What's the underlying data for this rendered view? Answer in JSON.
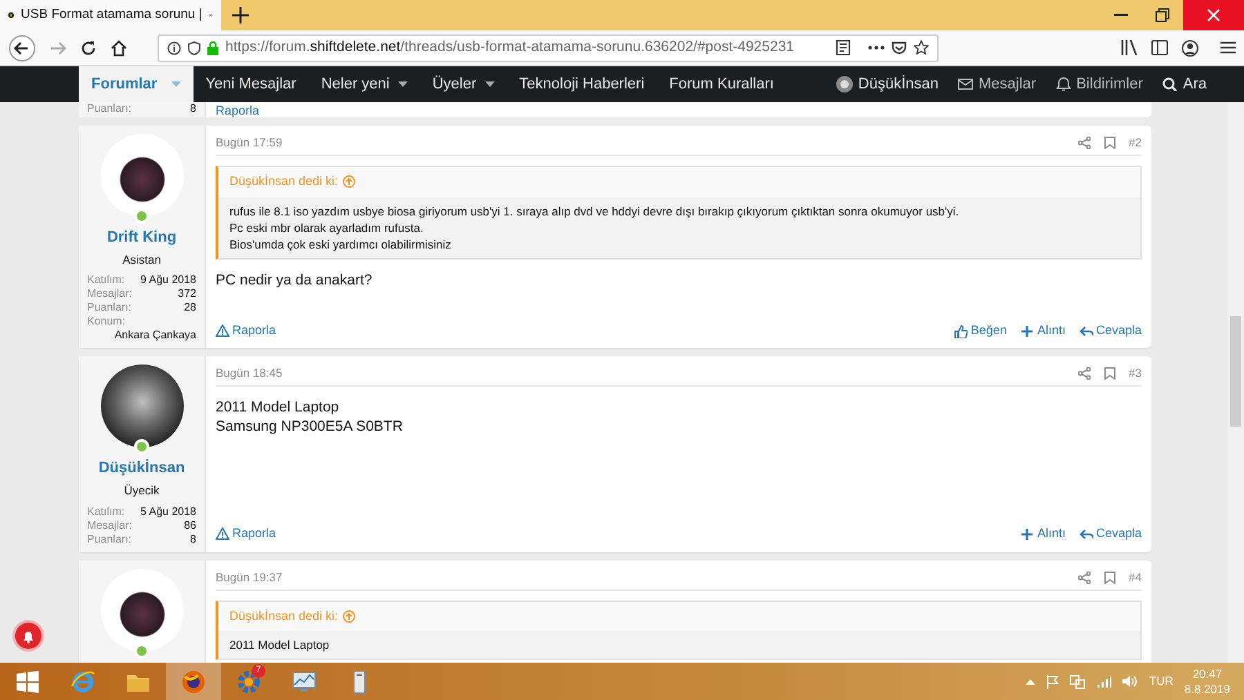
{
  "browser": {
    "tab_title": "USB Format atamama sorunu |",
    "url_prefix": "https://forum.",
    "url_domain": "shiftdelete.net",
    "url_path": "/threads/usb-format-atamama-sorunu.636202/#post-4925231"
  },
  "nav": {
    "items": [
      {
        "label": "Forumlar",
        "selected": true,
        "dropdown": true
      },
      {
        "label": "Yeni Mesajlar",
        "selected": false,
        "dropdown": false
      },
      {
        "label": "Neler yeni",
        "selected": false,
        "dropdown": true
      },
      {
        "label": "Üyeler",
        "selected": false,
        "dropdown": true
      },
      {
        "label": "Teknoloji Haberleri",
        "selected": false,
        "dropdown": false
      },
      {
        "label": "Forum Kuralları",
        "selected": false,
        "dropdown": false
      }
    ],
    "user": "Düşükİnsan",
    "links": [
      {
        "kind": "mail",
        "label": "Mesajlar"
      },
      {
        "kind": "bell",
        "label": "Bildirimler"
      },
      {
        "kind": "search",
        "label": "Ara"
      }
    ]
  },
  "previous_post": {
    "stat_label": "Puanları:",
    "stat_value": "8",
    "report": "Raporla"
  },
  "posts": [
    {
      "author": "Drift King",
      "user_title": "Asistan",
      "online": true,
      "stats": [
        {
          "label": "Katılım:",
          "value": "9 Ağu 2018"
        },
        {
          "label": "Mesajlar:",
          "value": "372"
        },
        {
          "label": "Puanları:",
          "value": "28"
        },
        {
          "label": "Konum:",
          "value": "Ankara Çankaya"
        }
      ],
      "time": "Bugün 17:59",
      "number": "#2",
      "quote": {
        "author_line": "Düşükİnsan dedi ki:",
        "lines": [
          "rufus ile 8.1 iso yazdım usbye biosa giriyorum usb'yi 1. sıraya alıp dvd ve hddyi devre dışı bırakıp çıkıyorum çıktıktan sonra okumuyor usb'yi.",
          "Pc eski mbr olarak ayarladım rufusta.",
          "Bios'umda çok eski yardımcı olabilirmisiniz"
        ]
      },
      "body": [
        "PC nedir ya da anakart?"
      ],
      "report": "Raporla",
      "actions": [
        {
          "kind": "like",
          "label": "Beğen"
        },
        {
          "kind": "quote",
          "label": "Alıntı"
        },
        {
          "kind": "reply",
          "label": "Cevapla"
        }
      ]
    },
    {
      "author": "Düşükİnsan",
      "user_title": "Üyecik",
      "online": true,
      "stats": [
        {
          "label": "Katılım:",
          "value": "5 Ağu 2018"
        },
        {
          "label": "Mesajlar:",
          "value": "86"
        },
        {
          "label": "Puanları:",
          "value": "8"
        }
      ],
      "time": "Bugün 18:45",
      "number": "#3",
      "body": [
        "2011 Model Laptop",
        "Samsung NP300E5A S0BTR"
      ],
      "report": "Raporla",
      "actions": [
        {
          "kind": "quote",
          "label": "Alıntı"
        },
        {
          "kind": "reply",
          "label": "Cevapla"
        }
      ]
    },
    {
      "online": true,
      "time": "Bugün 19:37",
      "number": "#4",
      "quote": {
        "author_line": "Düşükİnsan dedi ki:",
        "lines": [
          "2011 Model Laptop"
        ]
      }
    }
  ],
  "taskbar": {
    "apps": [
      {
        "kind": "ie",
        "selected": false
      },
      {
        "kind": "folder",
        "selected": false
      },
      {
        "kind": "firefox",
        "selected": true
      },
      {
        "kind": "gear",
        "selected": false,
        "badge": "7"
      },
      {
        "kind": "monitor",
        "selected": false
      },
      {
        "kind": "device",
        "selected": false
      }
    ],
    "language": "TUR",
    "time": "20:47",
    "date": "8.8.2019"
  }
}
